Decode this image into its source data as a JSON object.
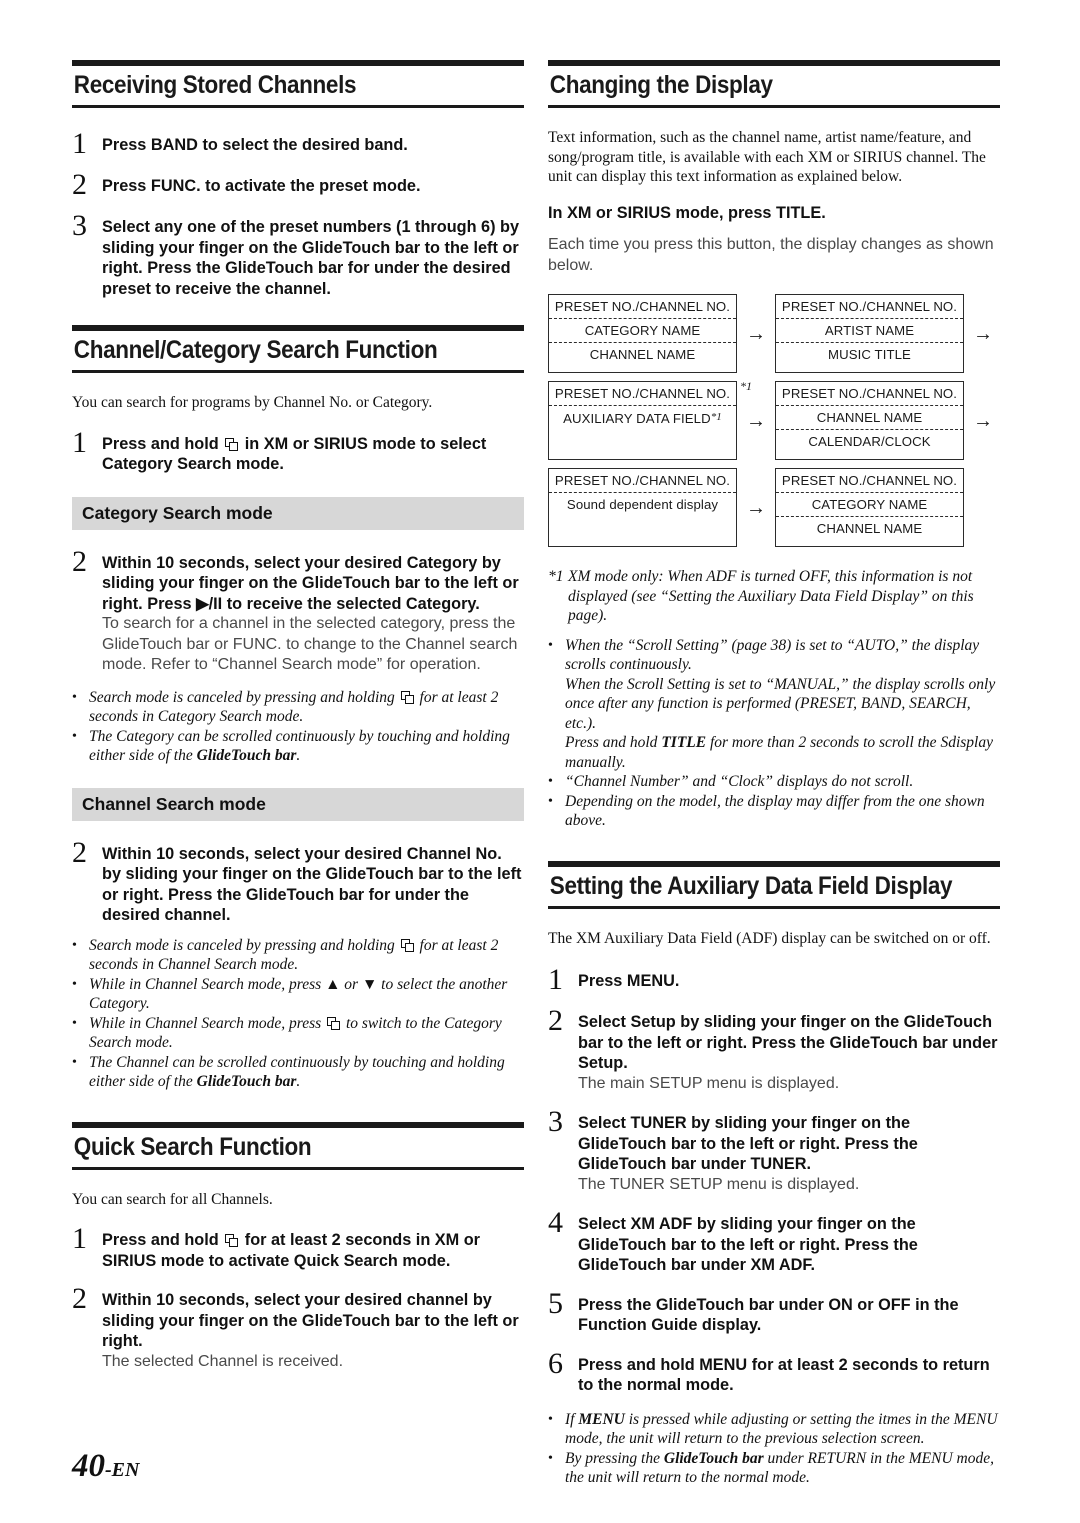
{
  "page": {
    "number": "40",
    "suffix": "-EN"
  },
  "left_column": {
    "section1": {
      "heading": "Receiving Stored Channels",
      "steps": [
        {
          "num": "1",
          "text_html": "Press <b>BAND</b> to select the desired band."
        },
        {
          "num": "2",
          "text_html": "Press <b>FUNC.</b> to activate the preset mode."
        },
        {
          "num": "3",
          "text_html": "Select any one of the preset numbers (1 through 6) by sliding your finger on the <b>GlideTouch bar</b> to the left or right. Press the <b>GlideTouch bar</b> for under the desired preset to receive the channel."
        }
      ]
    },
    "section2": {
      "heading": "Channel/Category Search Function",
      "intro": "You can search for programs by Channel No. or Category.",
      "step1": {
        "num": "1",
        "text_html": "Press and hold <span class=\"icon-pages\"></span> in XM or SIRIUS mode to select Category Search mode."
      },
      "sub1": {
        "title": "Category Search mode",
        "step": {
          "num": "2",
          "text_html": "Within 10 seconds, select your desired Category by sliding your finger on the <b>GlideTouch bar</b> to the left or right. Press <span class=\"glyph\">&#9654;/II</span> to receive the selected Category.",
          "sub_text": "To search for a channel in the selected category, press the GlideTouch bar or FUNC. to change to the Channel search mode. Refer to “Channel Search mode” for operation."
        },
        "notes": [
          "Search mode is canceled by pressing and holding <span class=\"icon-pages\"></span> for at least 2 seconds in Category Search mode.",
          "The Category can be scrolled continuously by touching and holding either side of the <b>GlideTouch bar</b>."
        ]
      },
      "sub2": {
        "title": "Channel Search mode",
        "step": {
          "num": "2",
          "text_html": "Within 10 seconds, select your desired Channel No. by sliding your finger on the <b>GlideTouch bar</b> to the left or right. Press the <b>GlideTouch bar</b> for under the desired channel."
        },
        "notes": [
          "Search mode is canceled by pressing and holding <span class=\"icon-pages\"></span> for at least 2 seconds in Channel Search mode.",
          "While in Channel Search mode, press <span class=\"glyph\">&#9650;</span> or <span class=\"glyph\">&#9660;</span> to select the another Category.",
          "While in Channel Search mode, press <span class=\"icon-pages\"></span> to switch to the Category Search mode.",
          "The Channel can be scrolled continuously by touching and holding either side of the <b>GlideTouch bar</b>."
        ]
      }
    },
    "section3": {
      "heading": "Quick Search Function",
      "intro": "You can search for all Channels.",
      "steps": [
        {
          "num": "1",
          "text_html": "Press and hold <span class=\"icon-pages\"></span> for at least 2 seconds in XM or SIRIUS mode to activate Quick Search mode."
        },
        {
          "num": "2",
          "text_html": "Within 10 seconds, select your desired channel by sliding your finger on the <b>GlideTouch bar</b> to the left or right.",
          "sub_text": "The selected Channel is received."
        }
      ]
    }
  },
  "right_column": {
    "section1": {
      "heading": "Changing the Display",
      "intro": "Text information, such as the channel name, artist name/feature, and song/program title, is available with each XM or SIRIUS channel. The unit can display this text information as explained below.",
      "mode_line_html": "In XM or SIRIUS mode, press <b>TITLE</b>.",
      "press_note": "Each time you press this button, the display changes as shown below.",
      "diagram": {
        "rows": [
          {
            "left": {
              "lines": [
                "PRESET NO./CHANNEL NO.",
                "CATEGORY  NAME",
                "CHANNEL NAME"
              ],
              "star": false,
              "inline_star": false
            },
            "arrow": "→",
            "right": {
              "lines": [
                "PRESET NO./CHANNEL NO.",
                "ARTIST NAME",
                "MUSIC TITLE"
              ],
              "star": false,
              "inline_star": false
            },
            "trailing_arrow": "→"
          },
          {
            "left": {
              "lines": [
                "PRESET NO./CHANNEL NO.",
                "AUXILIARY  DATA FIELD"
              ],
              "star": true,
              "inline_star": true
            },
            "arrow": "→",
            "right": {
              "lines": [
                "PRESET NO./CHANNEL NO.",
                "CHANNEL NAME",
                "CALENDAR/CLOCK"
              ],
              "star": false,
              "inline_star": false
            },
            "trailing_arrow": "→"
          },
          {
            "left": {
              "lines": [
                "PRESET NO./CHANNEL NO.",
                "Sound dependent display"
              ],
              "star": false,
              "inline_star": false
            },
            "arrow": "→",
            "right": {
              "lines": [
                "PRESET NO./CHANNEL NO.",
                "CATEGORY  NAME",
                "CHANNEL NAME"
              ],
              "star": false,
              "inline_star": false
            },
            "trailing_arrow": ""
          }
        ],
        "star_marker": "*1"
      },
      "footnote": {
        "marker": "*1",
        "text": "XM mode only: When ADF is turned OFF, this information is not displayed (see “Setting the Auxiliary Data Field Display” on this page)."
      },
      "notes": [
        "When the “Scroll Setting” (page 38) is set to “AUTO,” the display scrolls continuously.",
        "“Channel Number” and “Clock” displays do not scroll.",
        "Depending on the model, the display may differ from the one shown above."
      ],
      "note_continuation_1": "When the Scroll Setting is set to “MANUAL,” the display scrolls only once after any function is performed (PRESET, BAND, SEARCH, etc.).",
      "note_continuation_2_html": "Press and hold <b>TITLE</b> for more than 2 seconds to scroll the Sdisplay manually."
    },
    "section2": {
      "heading": "Setting the Auxiliary Data Field Display",
      "intro": "The XM Auxiliary Data Field (ADF) display can be switched on or off.",
      "steps": [
        {
          "num": "1",
          "text_html": "Press <b>MENU</b>."
        },
        {
          "num": "2",
          "text_html": "Select Setup by sliding your finger on the <b>GlideTouch bar</b> to the left or right. Press the <b>GlideTouch bar</b> under Setup.",
          "sub_text": "The main SETUP menu is displayed."
        },
        {
          "num": "3",
          "text_html": "Select TUNER by sliding your finger on the <b>GlideTouch bar</b> to the left or right. Press the <b>GlideTouch bar</b> under TUNER.",
          "sub_text": "The TUNER SETUP menu is displayed."
        },
        {
          "num": "4",
          "text_html": "Select XM ADF by sliding your finger on the <b>GlideTouch bar</b> to the left or right. Press the <b>GlideTouch bar</b> under XM ADF."
        },
        {
          "num": "5",
          "text_html": "Press the <b>GlideTouch bar</b> under ON or OFF in the Function Guide display."
        },
        {
          "num": "6",
          "text_html": "Press and hold <b>MENU</b> for at least 2 seconds to return to the normal mode."
        }
      ],
      "notes": [
        "If <b>MENU</b> is pressed while adjusting or setting the itmes in the MENU mode, the unit will return to the previous selection screen.",
        "By pressing the <b>GlideTouch bar</b> under RETURN in the MENU mode, the unit will return to the normal mode."
      ]
    }
  }
}
